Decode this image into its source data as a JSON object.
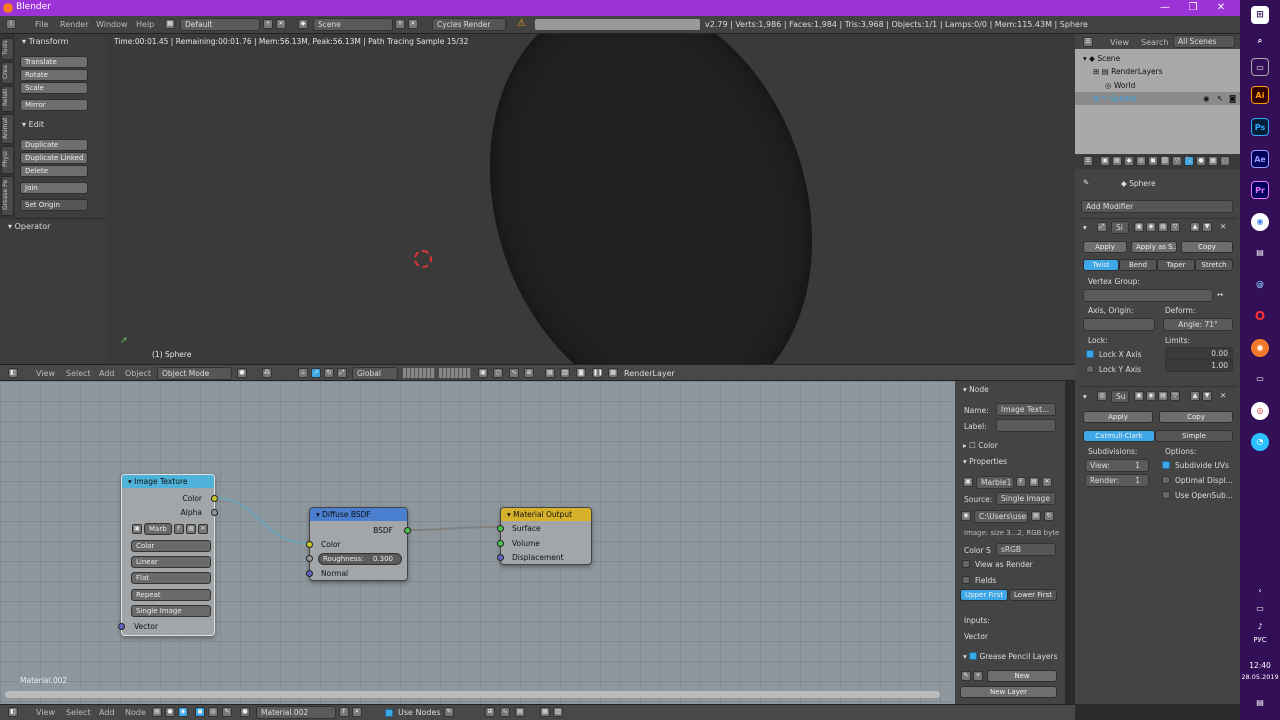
{
  "window": {
    "title": "Blender",
    "min": "—",
    "max": "❐",
    "close": "✕"
  },
  "menu": {
    "file": "File",
    "render": "Render",
    "window": "Window",
    "help": "Help",
    "layout": "Default",
    "scene": "Scene",
    "engine": "Cycles Render",
    "stats": "v2.79 | Verts:1,986 | Faces:1,984 | Tris:3,968 | Objects:1/1 | Lamps:0/0 | Mem:115.43M | Sphere"
  },
  "toolshelf": {
    "tabs": [
      "Tools",
      "Crea",
      "Relati",
      "Animat",
      "Physi",
      "Grease Pe"
    ],
    "transform_hdr": "Transform",
    "translate": "Translate",
    "rotate": "Rotate",
    "scale": "Scale",
    "mirror": "Mirror",
    "edit_hdr": "Edit",
    "duplicate": "Duplicate",
    "duplicate_linked": "Duplicate Linked",
    "delete": "Delete",
    "join": "Join",
    "set_origin": "Set Origin",
    "operator_hdr": "Operator"
  },
  "viewport": {
    "status": "Time:00:01.45 | Remaining:00:01.76 | Mem:56.13M, Peak:56.13M | Path Tracing Sample 15/32",
    "object_label": "(1) Sphere"
  },
  "view3d_header": {
    "view": "View",
    "select": "Select",
    "add": "Add",
    "object": "Object",
    "mode": "Object Mode",
    "orientation": "Global",
    "render_layer": "RenderLayer"
  },
  "nodes": {
    "image_texture": {
      "title": "Image Texture",
      "color": "Color",
      "alpha": "Alpha",
      "image": "Marb",
      "f": "F",
      "interp_color": "Color",
      "interp": "Linear",
      "proj": "Flat",
      "ext": "Repeat",
      "source": "Single Image",
      "vector": "Vector"
    },
    "diffuse": {
      "title": "Diffuse BSDF",
      "bsdf": "BSDF",
      "color": "Color",
      "roughness_label": "Roughness:",
      "roughness": "0.300",
      "normal": "Normal"
    },
    "output": {
      "title": "Material Output",
      "surface": "Surface",
      "volume": "Volume",
      "displacement": "Displacement"
    },
    "material_label": "Material.002"
  },
  "node_panel": {
    "node_hdr": "Node",
    "name_label": "Name:",
    "name_val": "Image Text...",
    "label_label": "Label:",
    "color_hdr": "Color",
    "properties_hdr": "Properties",
    "image": "Marble1",
    "f": "F",
    "source_label": "Source:",
    "source": "Single Image",
    "path": "C:\\Users\\user...",
    "image_info": "Image: size 3...2, RGB byte",
    "colorspace_label": "Color S",
    "colorspace": "sRGB",
    "view_as_render": "View as Render",
    "fields": "Fields",
    "upper_first": "Upper First",
    "lower_first": "Lower First",
    "inputs": "Inputs:",
    "vector": "Vector",
    "gp_layers": "Grease Pencil Layers",
    "new": "New",
    "new_layer": "New Layer"
  },
  "outliner": {
    "view": "View",
    "search": "Search",
    "all_scenes": "All Scenes",
    "scene": "Scene",
    "render_layers": "RenderLayers",
    "world": "World",
    "sphere": "Sphere"
  },
  "properties": {
    "object": "Sphere",
    "add_modifier": "Add Modifier",
    "mod1": {
      "name": "Si",
      "apply": "Apply",
      "apply_as": "Apply as S...",
      "copy": "Copy",
      "twist": "Twist",
      "bend": "Bend",
      "taper": "Taper",
      "stretch": "Stretch",
      "vertex_group": "Vertex Group:",
      "axis_origin": "Axis, Origin:",
      "deform": "Deform:",
      "angle": "Angle:",
      "angle_val": "71°",
      "lock": "Lock:",
      "limits": "Limits:",
      "lock_x": "Lock X Axis",
      "lock_y": "Lock Y Axis",
      "limit1": "0.00",
      "limit2": "1.00"
    },
    "mod2": {
      "name": "Su",
      "apply": "Apply",
      "copy": "Copy",
      "catmull": "Catmull-Clark",
      "simple": "Simple",
      "subdivisions": "Subdivisions:",
      "options": "Options:",
      "view": "View:",
      "view_val": "1",
      "render": "Render:",
      "render_val": "1",
      "subdivide_uvs": "Subdivide UVs",
      "optimal": "Optimal Displ...",
      "opensubdiv": "Use OpenSub..."
    }
  },
  "node_header": {
    "view": "View",
    "select": "Select",
    "add": "Add",
    "node": "Node",
    "material": "Material.002",
    "f": "F",
    "use_nodes": "Use Nodes"
  },
  "taskbar": {
    "lang": "РУС",
    "time": "12:40",
    "date": "28.05.2019"
  },
  "colors": {
    "accent": "#9b33d6",
    "node_tex": "#4fb3d9",
    "node_shader": "#4a7fd0",
    "node_output": "#d6b12a",
    "selected": "#3ea7e8"
  }
}
